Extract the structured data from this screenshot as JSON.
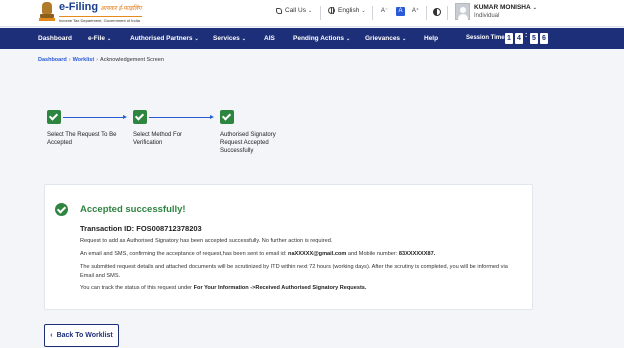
{
  "header": {
    "logo_title": "e-Filing",
    "logo_hindi": "आयकर ई-फाइलिंग",
    "logo_sub": "Income Tax Department, Government of India",
    "call_us": "Call Us",
    "language": "English",
    "font_small": "A⁻",
    "font_normal": "A",
    "font_large": "A⁺",
    "user_name": "KUMAR MONISHA",
    "user_role": "Individual"
  },
  "nav": {
    "items": [
      "Dashboard",
      "e-File",
      "Authorised Partners",
      "Services",
      "AIS",
      "Pending Actions",
      "Grievances",
      "Help"
    ],
    "session_label": "Session Time",
    "session_digits": [
      "1",
      "4",
      "5",
      "6"
    ]
  },
  "breadcrumb": {
    "items": [
      "Dashboard",
      "Worklist",
      "Acknowledgement Screen"
    ]
  },
  "steps": [
    {
      "label": "Select The Request To Be Accepted"
    },
    {
      "label": "Select Method For Verification"
    },
    {
      "label": "Authorised Signatory Request Accepted Successfully"
    }
  ],
  "result": {
    "title": "Accepted successfully!",
    "transaction": "Transaction ID: FOS008712378203",
    "line1": "Request to add as Authorised Signatory has been accepted successfully. No further action is required.",
    "line2_pre": "An email and SMS, confirming the acceptance of request,has been sent to email id: ",
    "line2_email": "naXXXXX@gmail.com",
    "line2_mid": " and Mobile number: ",
    "line2_mobile": "83XXXXXX87.",
    "line3": "The submitted request details and attached documents will be scrutinized by ITD within next 72 hours (working days). After the scrutiny is completed, you will be informed via Email and SMS.",
    "line4_pre": "You can track the status of this request under ",
    "line4_bold": "For Your Information ->Received Authorised Signatory Requests."
  },
  "back_button": "Back To Worklist",
  "colors": {
    "nav_bg": "#1e2f7a",
    "success": "#2e8540",
    "link": "#2a5bd7"
  }
}
